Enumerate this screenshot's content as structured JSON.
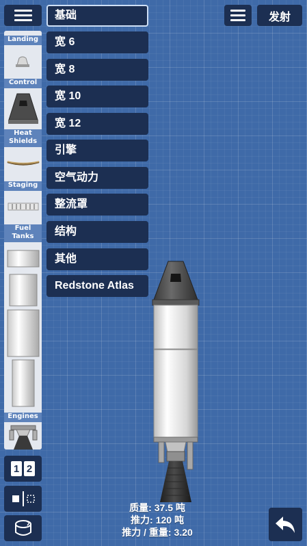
{
  "header": {
    "launch_label": "发射"
  },
  "sidebar": {
    "categories": [
      "Landing",
      "Control",
      "Heat Shields",
      "Staging",
      "Fuel Tanks",
      "Engines"
    ],
    "stage_toggle": {
      "one": "1",
      "two": "2"
    }
  },
  "menu": {
    "items": [
      "基础",
      "宽 6",
      "宽 8",
      "宽 10",
      "宽 12",
      "引擎",
      "空气动力",
      "整流罩",
      "结构",
      "其他",
      "Redstone Atlas"
    ],
    "selected_index": 0
  },
  "stats": {
    "mass_label": "质量:",
    "mass_value": "37.5 吨",
    "thrust_label": "推力:",
    "thrust_value": "120 吨",
    "ratio_label": "推力 / 重量:",
    "ratio_value": "3.20"
  },
  "colors": {
    "panel": "#1c2f52",
    "background": "#3f6aa8",
    "category": "#5e83bb",
    "sidebar": "#e4e8ef"
  },
  "icons": [
    "menu-icon",
    "undo-icon",
    "rotate-icon",
    "symmetry-icon"
  ]
}
